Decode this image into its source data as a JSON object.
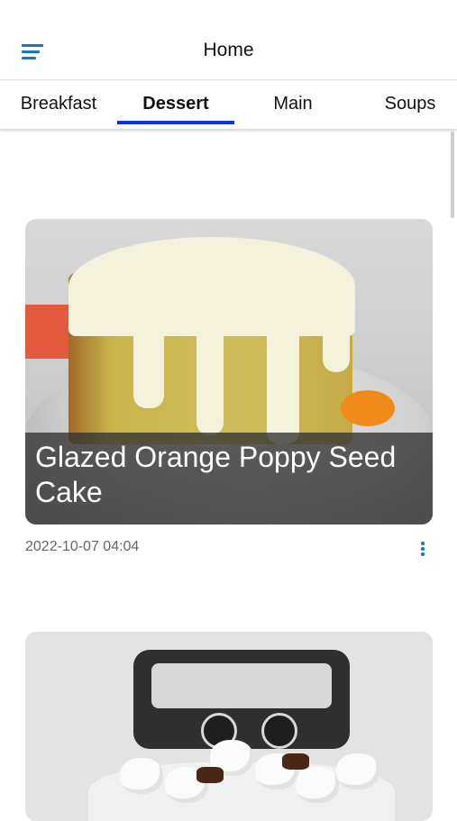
{
  "header": {
    "title": "Home",
    "menu_icon": "menu-icon"
  },
  "tabs": [
    {
      "label": "Breakfast"
    },
    {
      "label": "Dessert",
      "active": true
    },
    {
      "label": "Main"
    },
    {
      "label": "Soups"
    }
  ],
  "colors": {
    "accent": "#1a73c7",
    "tab_indicator": "#1432d6"
  },
  "recipes": [
    {
      "title": "Glazed Orange Poppy Seed Cake",
      "date": "2022-10-07 04:04",
      "more_icon": "more-vertical-icon"
    },
    {
      "title": "",
      "date": ""
    }
  ]
}
